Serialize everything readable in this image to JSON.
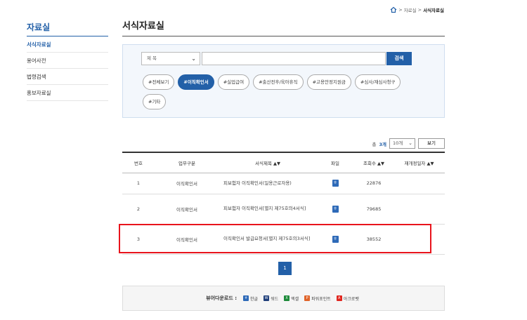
{
  "breadcrumb": {
    "parent": "자료실",
    "current": "서식자료실"
  },
  "sidebar": {
    "title": "자료실",
    "items": [
      {
        "label": "서식자료실",
        "active": true
      },
      {
        "label": "용어사전"
      },
      {
        "label": "법령검색"
      },
      {
        "label": "홍보자료실"
      }
    ]
  },
  "page_title": "서식자료실",
  "search": {
    "select_value": "제 목",
    "input_value": "",
    "button_label": "검색"
  },
  "tags": [
    {
      "label": "#전체보기"
    },
    {
      "label": "#이직확인서",
      "active": true
    },
    {
      "label": "#실업급여"
    },
    {
      "label": "#출산전후/육아휴직"
    },
    {
      "label": "#고용안정지원금"
    },
    {
      "label": "#심사/재심사청구"
    },
    {
      "label": "#기타"
    }
  ],
  "list_meta": {
    "total_prefix": "총",
    "total_count": "3개",
    "page_size": "10개",
    "view_button": "보기"
  },
  "table": {
    "headers": [
      "번호",
      "업무구분",
      "서식제목 ▲▼",
      "파일",
      "조회수 ▲▼",
      "재개정일자 ▲▼"
    ],
    "rows": [
      {
        "no": "1",
        "category": "이직확인서",
        "subject": "피보험자 이직확인서(일용근로자용)",
        "views": "22876",
        "date": ""
      },
      {
        "no": "2",
        "category": "이직확인서",
        "subject": "피보험자 이직확인서[별지 제75호의4서식]",
        "views": "79685",
        "date": ""
      },
      {
        "no": "3",
        "category": "이직확인서",
        "subject": "이직확인서 발급요청서[별지 제75호의3서식]",
        "views": "38552",
        "date": ""
      }
    ]
  },
  "pagination": {
    "current": "1"
  },
  "viewer": {
    "label": "뷰어다운로드 :",
    "items": [
      {
        "name": "한글",
        "icon": "hwp-icon",
        "color": "#2e6ab8",
        "glyph": "ㅎ"
      },
      {
        "name": "워드",
        "icon": "word-icon",
        "color": "#1f3f7a",
        "glyph": "W"
      },
      {
        "name": "엑셀",
        "icon": "excel-icon",
        "color": "#1d8a3a",
        "glyph": "X"
      },
      {
        "name": "파워포인트",
        "icon": "powerpoint-icon",
        "color": "#e0642a",
        "glyph": "P"
      },
      {
        "name": "아크로벳",
        "icon": "acrobat-icon",
        "color": "#e0261f",
        "glyph": "A"
      }
    ]
  },
  "colors": {
    "accent": "#2360a8",
    "highlight": "#e8141c"
  }
}
